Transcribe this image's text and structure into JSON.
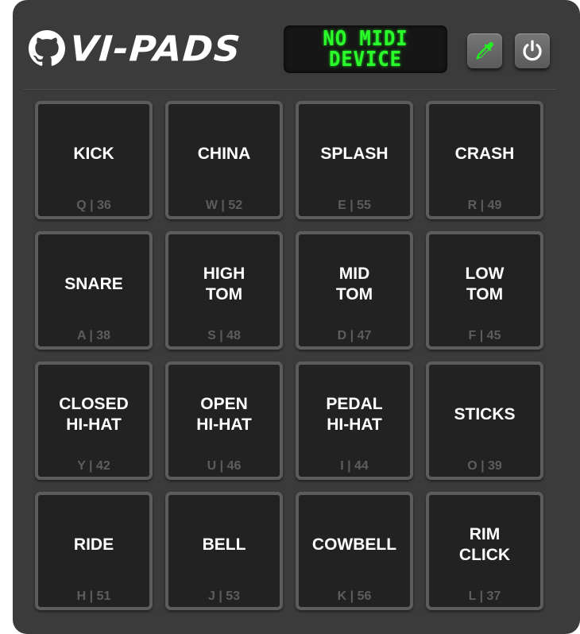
{
  "app": {
    "title": "VI-PADS",
    "logo_icon": "github-icon"
  },
  "header": {
    "display_line1": "NO MIDI",
    "display_line2": "DEVICE",
    "display_color": "#2bff2b",
    "picker_icon": "eyedropper-icon",
    "power_icon": "power-icon"
  },
  "pads": [
    {
      "label": "KICK",
      "key": "Q | 36"
    },
    {
      "label": "CHINA",
      "key": "W | 52"
    },
    {
      "label": "SPLASH",
      "key": "E | 55"
    },
    {
      "label": "CRASH",
      "key": "R | 49"
    },
    {
      "label": "SNARE",
      "key": "A | 38"
    },
    {
      "label": "HIGH\nTOM",
      "key": "S | 48"
    },
    {
      "label": "MID\nTOM",
      "key": "D | 47"
    },
    {
      "label": "LOW\nTOM",
      "key": "F | 45"
    },
    {
      "label": "CLOSED\nHI-HAT",
      "key": "Y | 42"
    },
    {
      "label": "OPEN\nHI-HAT",
      "key": "U | 46"
    },
    {
      "label": "PEDAL\nHI-HAT",
      "key": "I | 44"
    },
    {
      "label": "STICKS",
      "key": "O | 39"
    },
    {
      "label": "RIDE",
      "key": "H | 51"
    },
    {
      "label": "BELL",
      "key": "J | 53"
    },
    {
      "label": "COWBELL",
      "key": "K | 56"
    },
    {
      "label": "RIM\nCLICK",
      "key": "L | 37"
    }
  ]
}
